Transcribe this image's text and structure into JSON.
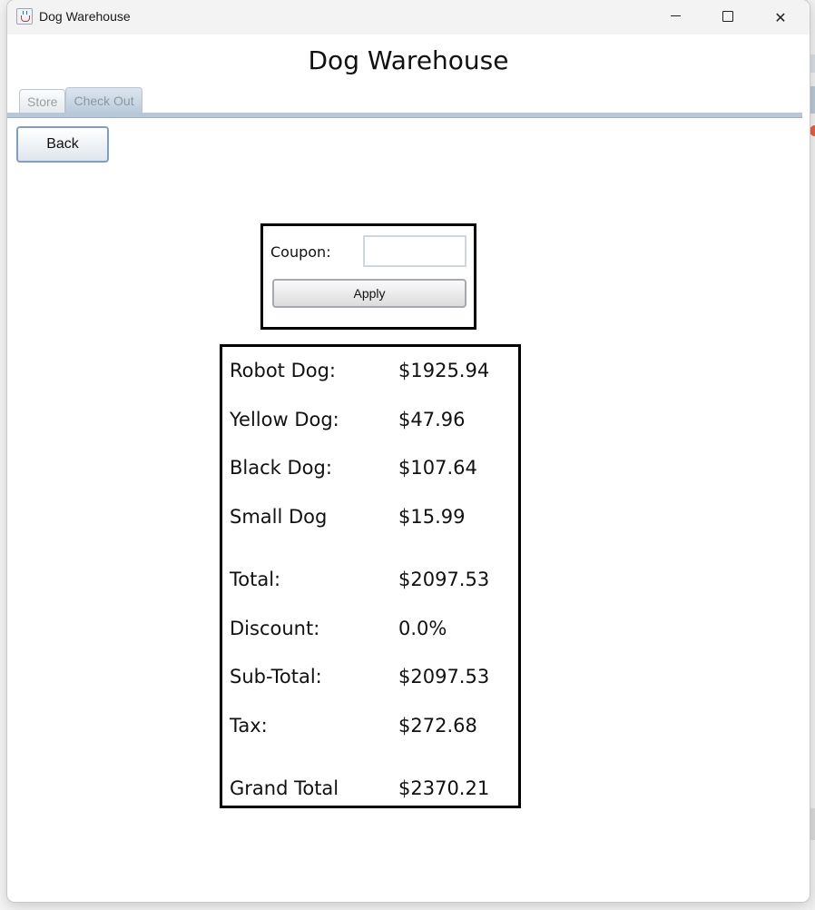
{
  "window": {
    "title": "Dog Warehouse",
    "minimize_icon": "minimize-icon",
    "maximize_icon": "maximize-icon",
    "close_icon": "close-icon",
    "close_glyph": "✕"
  },
  "heading": "Dog Warehouse",
  "tabs": [
    {
      "label": "Store",
      "selected": false
    },
    {
      "label": "Check Out",
      "selected": true
    }
  ],
  "back_button": {
    "label": "Back"
  },
  "coupon": {
    "label": "Coupon:",
    "value": "",
    "placeholder": "",
    "apply_label": "Apply"
  },
  "items": [
    {
      "name": "Robot Dog:",
      "price": "$1925.94"
    },
    {
      "name": "Yellow Dog:",
      "price": "$47.96"
    },
    {
      "name": "Black Dog:",
      "price": "$107.64"
    },
    {
      "name": "Small Dog",
      "price": "$15.99"
    }
  ],
  "totals": [
    {
      "name": "Total:",
      "value": "$2097.53"
    },
    {
      "name": "Discount:",
      "value": "0.0%"
    },
    {
      "name": "Sub-Total:",
      "value": "$2097.53"
    },
    {
      "name": "Tax:",
      "value": "$272.68"
    },
    {
      "name": "Grand Total",
      "value": "$2370.21"
    }
  ],
  "colors": {
    "accent": "#7ea0bf",
    "tab_rule": "#b8c7d6",
    "border": "#000000"
  }
}
